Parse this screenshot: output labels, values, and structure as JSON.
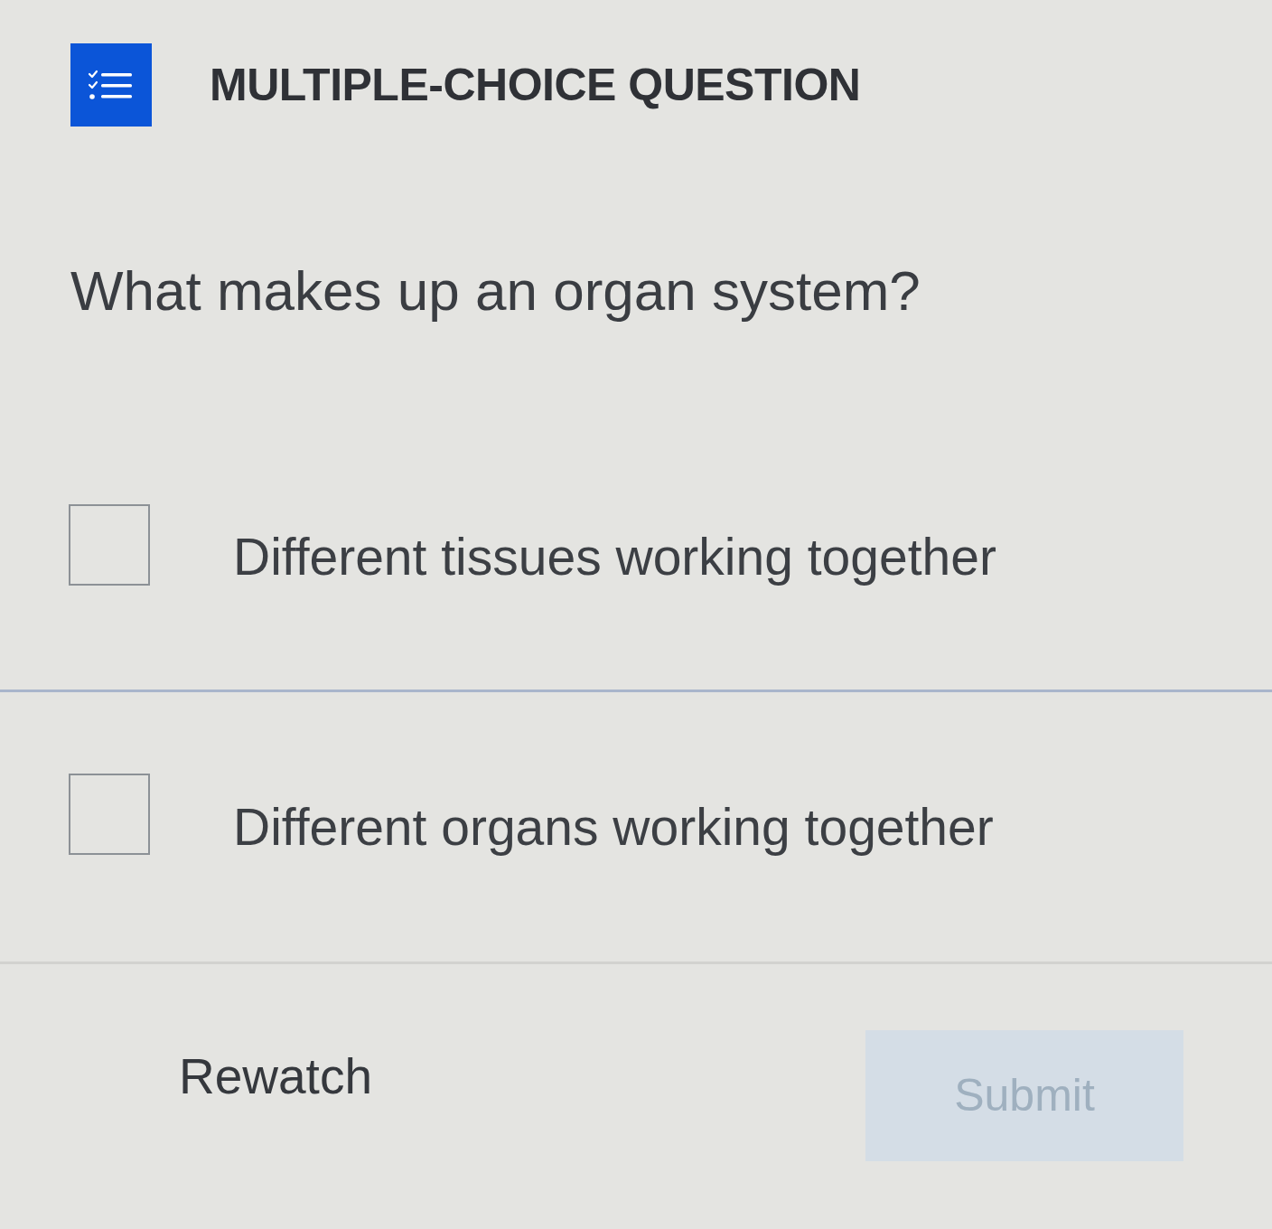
{
  "header": {
    "title": "MULTIPLE-CHOICE QUESTION"
  },
  "question": "What makes up an organ system?",
  "options": [
    {
      "label": "Different tissues working together",
      "checked": false
    },
    {
      "label": "Different organs working together",
      "checked": false
    }
  ],
  "actions": {
    "rewatch": {
      "label": "Rewatch"
    },
    "submit": {
      "label": "Submit",
      "disabled": true
    }
  }
}
